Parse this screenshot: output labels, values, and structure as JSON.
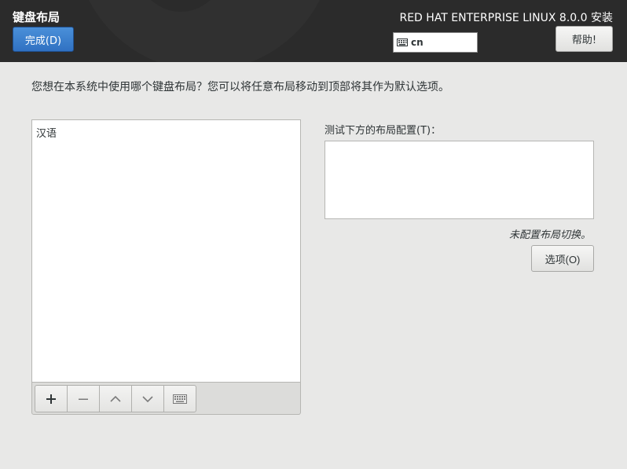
{
  "header": {
    "title": "键盘布局",
    "done_label": "完成(D)",
    "product": "RED HAT ENTERPRISE LINUX 8.0.0 安装",
    "keyboard_indicator": "cn",
    "help_label": "帮助!"
  },
  "main": {
    "prompt": "您想在本系统中使用哪个键盘布局？您可以将任意布局移动到顶部将其作为默认选项。",
    "layouts": [
      {
        "label": "汉语"
      }
    ],
    "toolbar": {
      "add_icon": "plus-icon",
      "remove_icon": "minus-icon",
      "up_icon": "chevron-up-icon",
      "down_icon": "chevron-down-icon",
      "preview_icon": "keyboard-icon"
    },
    "test_label": "测试下方的布局配置(T)：",
    "test_value": "",
    "switch_note": "未配置布局切换。",
    "options_label": "选项(O)"
  },
  "colors": {
    "header_bg": "#2b2b2b",
    "accent": "#3b80cf",
    "page_bg": "#e8e8e7"
  }
}
